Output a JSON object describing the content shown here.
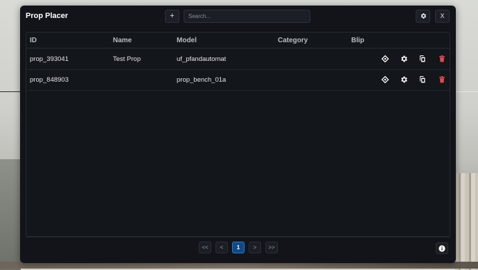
{
  "app": {
    "title": "Prop Placer"
  },
  "toolbar": {
    "add_label": "+",
    "search_placeholder": "Search...",
    "settings_icon": "gear-icon",
    "close_label": "X"
  },
  "table": {
    "headers": {
      "id": "ID",
      "name": "Name",
      "model": "Model",
      "category": "Category",
      "blip": "Blip"
    },
    "rows": [
      {
        "id": "prop_393041",
        "name": "Test Prop",
        "model": "uf_pfandautomat",
        "category": "",
        "blip": ""
      },
      {
        "id": "prop_848903",
        "name": "",
        "model": "prop_bench_01a",
        "category": "",
        "blip": ""
      }
    ],
    "row_actions": [
      "locate-icon",
      "gear-icon",
      "copy-icon",
      "trash-icon"
    ]
  },
  "pagination": {
    "first": "<<",
    "prev": "<",
    "current": "1",
    "next": ">",
    "last": ">>"
  },
  "colors": {
    "window_bg": "#121419",
    "accent": "#0f4a86",
    "danger": "#e5484d"
  }
}
